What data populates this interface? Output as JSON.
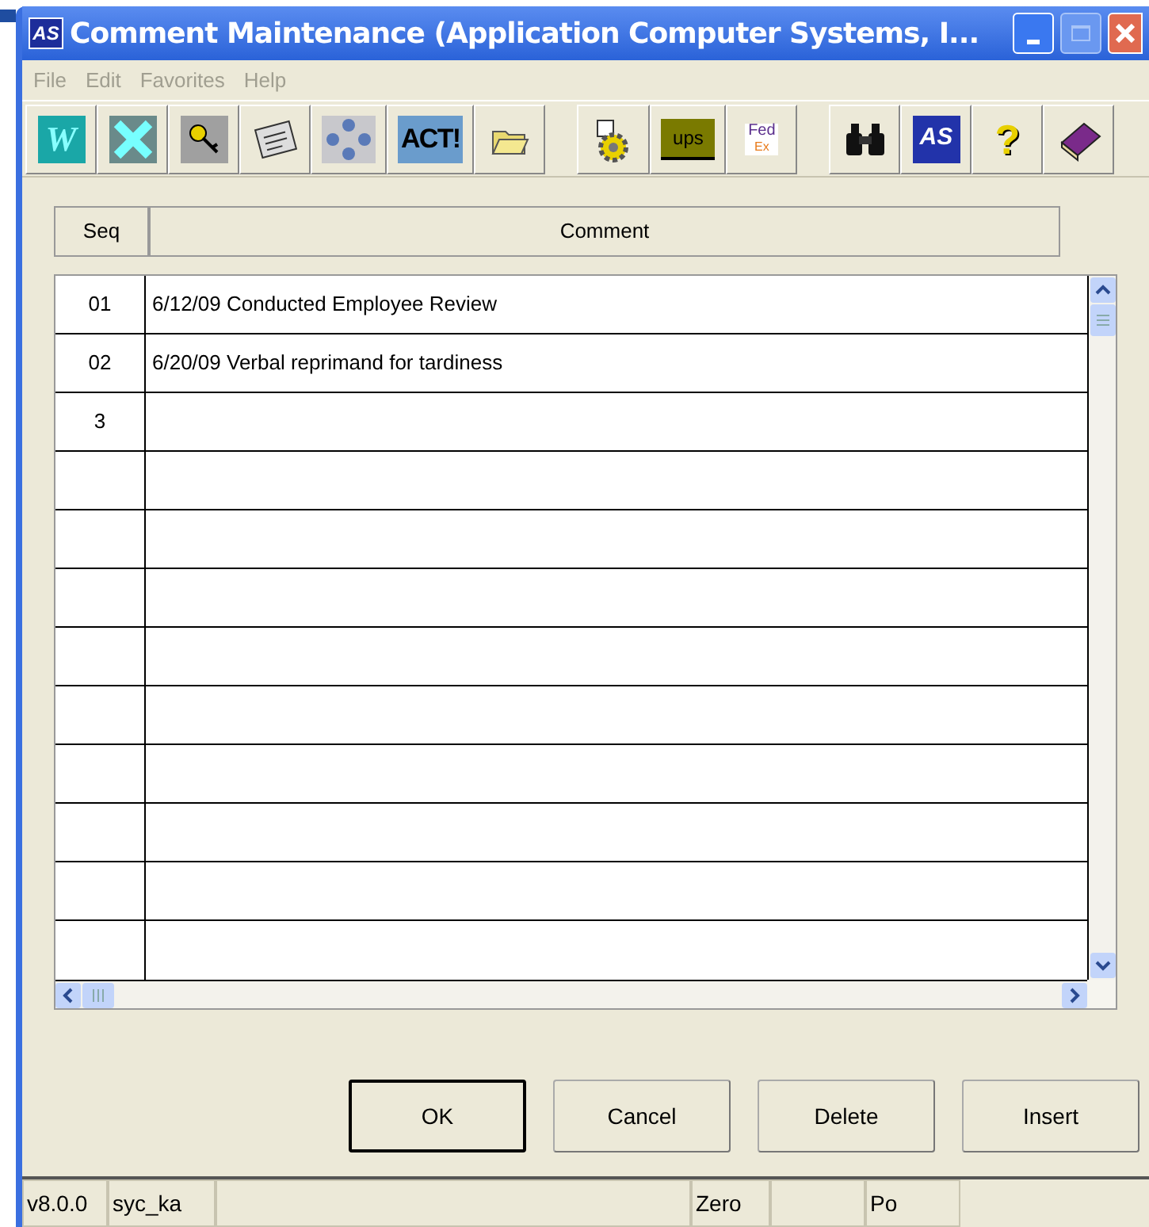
{
  "window": {
    "title": "Comment Maintenance (Application Computer Systems, I...",
    "logo": "AS"
  },
  "menu": [
    "File",
    "Edit",
    "Favorites",
    "Help"
  ],
  "toolbar": [
    {
      "kind": "word",
      "label": "W"
    },
    {
      "kind": "excel"
    },
    {
      "kind": "key"
    },
    {
      "kind": "notes"
    },
    {
      "kind": "dots"
    },
    {
      "kind": "act",
      "label": "ACT!"
    },
    {
      "kind": "folder"
    },
    {
      "kind": "gap"
    },
    {
      "kind": "gear"
    },
    {
      "kind": "ups",
      "label": "ups"
    },
    {
      "kind": "fedex",
      "label": "Fed",
      "label2": "Ex"
    },
    {
      "kind": "gap"
    },
    {
      "kind": "binoculars"
    },
    {
      "kind": "as",
      "label": "AS"
    },
    {
      "kind": "help",
      "label": "?"
    },
    {
      "kind": "book"
    }
  ],
  "table": {
    "columns": [
      "Seq",
      "Comment"
    ],
    "rows": [
      {
        "seq": "01",
        "comment": "6/12/09 Conducted Employee Review"
      },
      {
        "seq": "02",
        "comment": "6/20/09 Verbal reprimand for tardiness"
      },
      {
        "seq": "3"
      }
    ]
  },
  "buttons": [
    {
      "label": "OK",
      "default": true
    },
    {
      "label": "Cancel",
      "default": false
    },
    {
      "label": "Delete",
      "default": false
    },
    {
      "label": "Insert",
      "default": false
    }
  ],
  "status_bar": {
    "version": "v8.0.0",
    "user": "syc_ka",
    "mode": "Zero",
    "panel_6": "Po"
  }
}
